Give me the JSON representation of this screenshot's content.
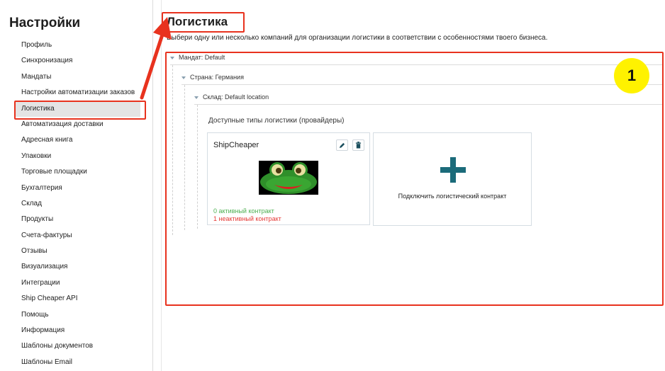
{
  "sidebar": {
    "title": "Настройки",
    "items": [
      "Профиль",
      "Синхронизация",
      "Мандаты",
      "Настройки автоматизации заказов",
      "Логистика",
      "Автоматизация доставки",
      "Адресная книга",
      "Упаковки",
      "Торговые площадки",
      "Бухгалтерия",
      "Склад",
      "Продукты",
      "Счета-фактуры",
      "Отзывы",
      "Визуализация",
      "Интеграции",
      "Ship Cheaper API",
      "Помощь",
      "Информация",
      "Шаблоны документов",
      "Шаблоны Email"
    ],
    "active_item": "Логистика"
  },
  "main": {
    "title": "Логистика",
    "description": "Выбери одну или несколько компаний для организации логистики в соответствии с особенностями твоего бизнеса.",
    "tree": {
      "mandat": "Мандат: Default",
      "country": "Страна: Германия",
      "warehouse": "Склад: Default location"
    },
    "providers_label": "Доступные типы логистики (провайдеры)",
    "provider_card": {
      "name": "ShipCheaper",
      "edit_icon": "pencil-icon",
      "delete_icon": "trash-icon",
      "active_status": "0 активный контракт",
      "inactive_status": "1 неактивный контракт"
    },
    "add_card": {
      "icon": "plus-icon",
      "label": "Подключить логистический контракт"
    }
  },
  "annotation": {
    "badge": "1",
    "highlight_color": "#e8321e",
    "badge_color": "#fff200"
  }
}
